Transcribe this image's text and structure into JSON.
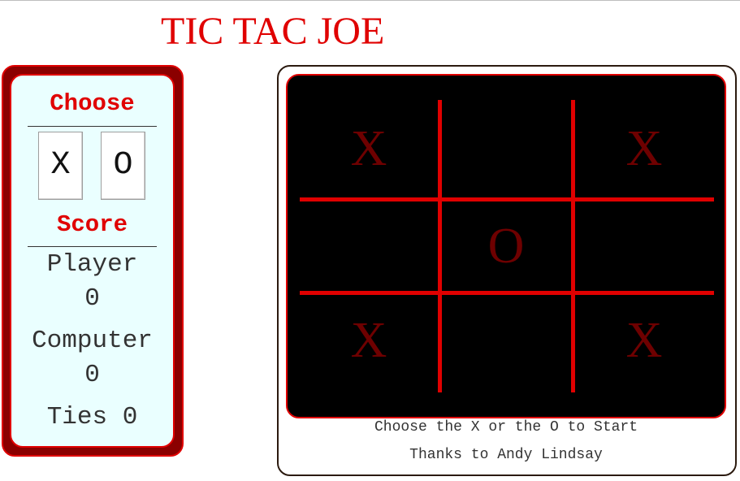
{
  "title": "TIC TAC JOE",
  "side": {
    "choose_heading": "Choose",
    "choices": [
      "X",
      "O"
    ],
    "score_heading": "Score",
    "player_label": "Player",
    "player_score": "0",
    "computer_label": "Computer",
    "computer_score": "0",
    "ties_text": "Ties 0"
  },
  "board": {
    "cells": [
      "X",
      "",
      "X",
      "",
      "O",
      "",
      "X",
      "",
      "X"
    ],
    "colors": {
      "background": "#000000",
      "grid": "#e00000",
      "marks": "#6e0000"
    }
  },
  "footer": {
    "instruction": "Choose the X or the O to Start",
    "credit": "Thanks to Andy Lindsay"
  },
  "colors": {
    "accent": "#e00000",
    "panel_outer": "#8b0000",
    "panel_inner": "#eaffff"
  }
}
